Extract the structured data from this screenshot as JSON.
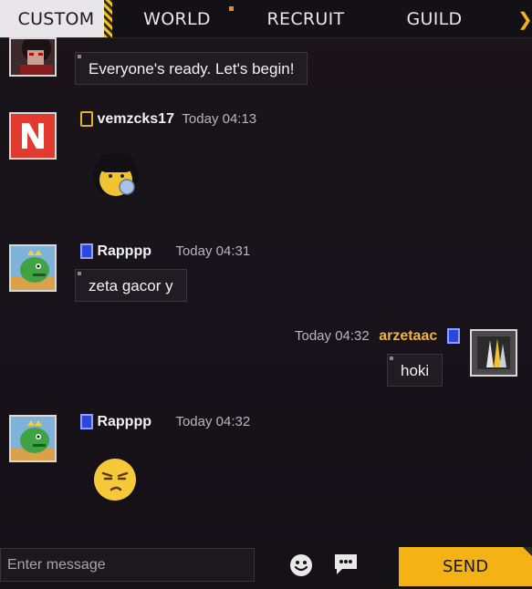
{
  "tabs": [
    "CUSTOM",
    "WORLD",
    "RECRUIT",
    "GUILD"
  ],
  "messages": [
    {
      "text": "Everyone's ready. Let's begin!"
    },
    {
      "user": "vemzcks17",
      "time": "Today 04:13",
      "emoji": "bubblegum-face"
    },
    {
      "user": "Rapppp",
      "time": "Today 04:31",
      "text": "zeta gacor y"
    },
    {
      "user": "arzetaac",
      "time": "Today 04:32",
      "text": "hoki"
    },
    {
      "user": "Rapppp",
      "time": "Today 04:32",
      "emoji": "smirk-face"
    }
  ],
  "input": {
    "placeholder": "Enter message"
  },
  "send_label": "SEND",
  "icons": [
    "emoji-icon",
    "chat-bubble-icon",
    "chevron-right-icon"
  ],
  "colors": {
    "accent": "#f5b214",
    "self_name": "#f2b33c",
    "active_tab": "#e8e6e8"
  }
}
